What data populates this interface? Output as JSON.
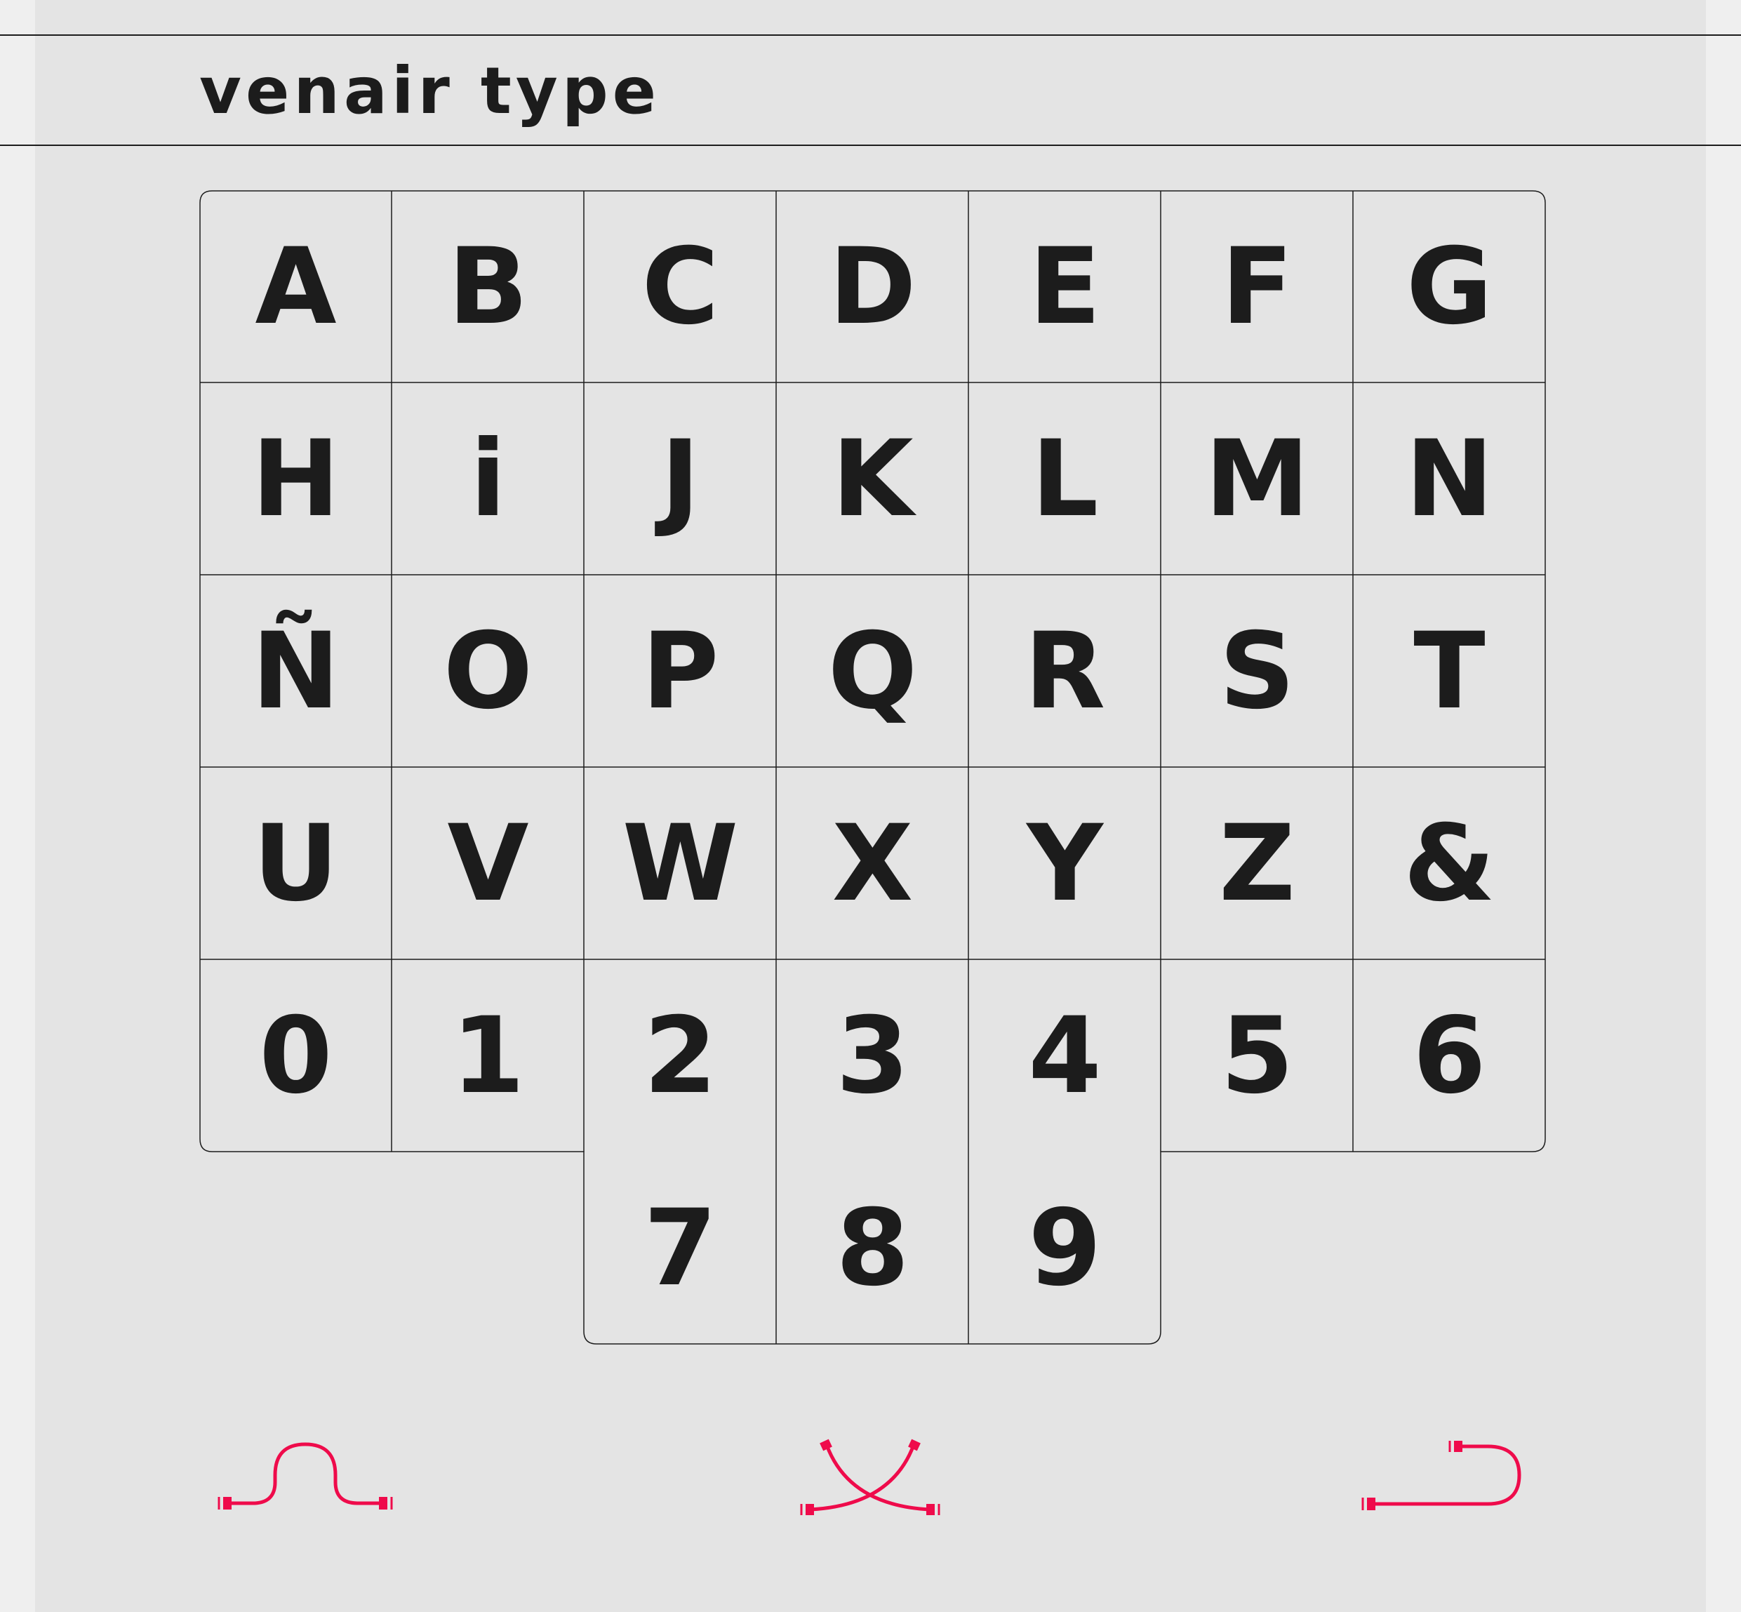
{
  "title": "VenAir TYPE",
  "glyphs": [
    [
      "A",
      "B",
      "C",
      "D",
      "E",
      "F",
      "G"
    ],
    [
      "H",
      "i",
      "J",
      "K",
      "L",
      "M",
      "N"
    ],
    [
      "Ñ",
      "O",
      "P",
      "Q",
      "R",
      "S",
      "T"
    ],
    [
      "U",
      "V",
      "W",
      "X",
      "Y",
      "Z",
      "&"
    ],
    [
      "0",
      "1",
      "2",
      "3",
      "4",
      "5",
      "6"
    ],
    [
      "",
      "",
      "7",
      "8",
      "9",
      "",
      ""
    ]
  ],
  "accent_color": "#ef0b4b",
  "ink_color": "#1c1c1c",
  "tools": [
    "wave-curve-icon",
    "crossed-curves-icon",
    "hook-curve-icon"
  ]
}
